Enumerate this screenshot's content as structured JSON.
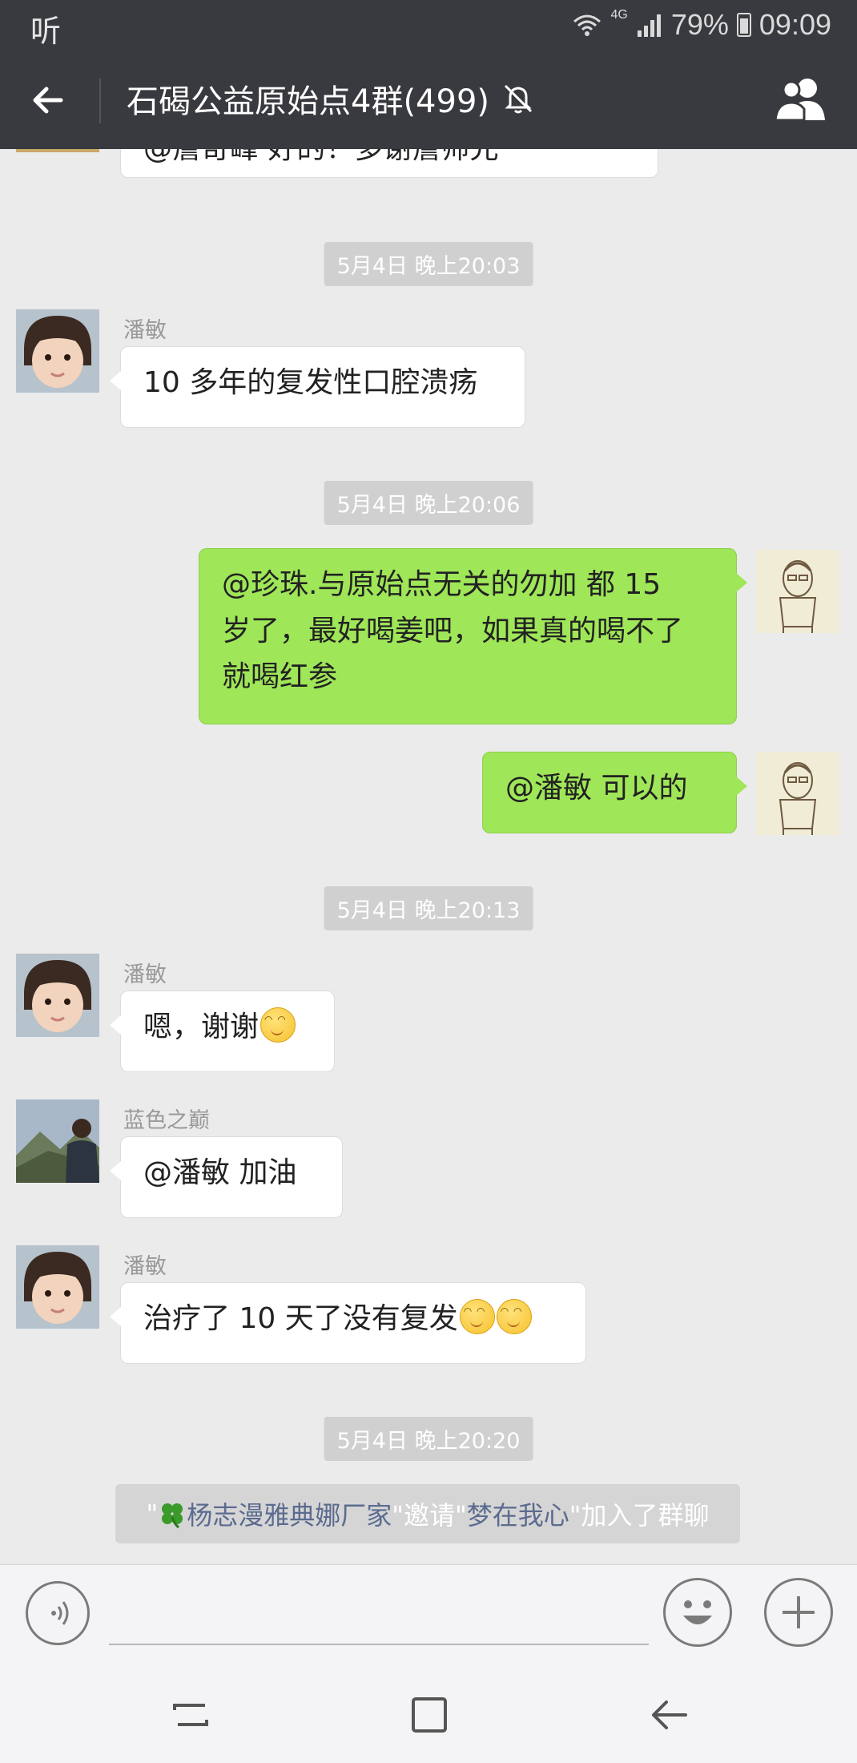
{
  "status_bar": {
    "left_app_label": "听",
    "network_type": "4G",
    "battery": "79%",
    "time": "09:09"
  },
  "header": {
    "title": "石碣公益原始点4群(499)",
    "icons": [
      "back-arrow-icon",
      "mute-bell-icon",
      "members-icon"
    ]
  },
  "chat": {
    "partial_top_message": "@詹奇峰 好的！多谢詹师兄",
    "items": [
      {
        "type": "timestamp",
        "text": "5月4日 晚上20:03"
      },
      {
        "type": "message",
        "side": "left",
        "sender": "潘敏",
        "text": "10 多年的复发性口腔溃疡"
      },
      {
        "type": "timestamp",
        "text": "5月4日 晚上20:06"
      },
      {
        "type": "message",
        "side": "right",
        "lines": [
          "@珍珠.与原始点无关的勿加  都 15",
          "岁了，最好喝姜吧，如果真的喝不了",
          "就喝红参"
        ]
      },
      {
        "type": "message",
        "side": "right",
        "text": "@潘敏  可以的"
      },
      {
        "type": "timestamp",
        "text": "5月4日 晚上20:13"
      },
      {
        "type": "message",
        "side": "left",
        "sender": "潘敏",
        "text": "嗯，谢谢",
        "emoji_count": 1
      },
      {
        "type": "message",
        "side": "left",
        "sender": "蓝色之巅",
        "text": "@潘敏  加油"
      },
      {
        "type": "message",
        "side": "left",
        "sender": "潘敏",
        "text": "治疗了 10 天了没有复发",
        "emoji_count": 2
      },
      {
        "type": "timestamp",
        "text": "5月4日 晚上20:20"
      }
    ],
    "system_message": {
      "quote_open": "\"",
      "inviter": "杨志漫雅典娜厂家",
      "mid": "\"邀请\"",
      "invitee": "梦在我心",
      "tail": "\"加入了群聊"
    }
  },
  "input_bar": {
    "icons": [
      "voice-icon",
      "emoji-icon",
      "plus-icon"
    ],
    "text_value": ""
  },
  "colors": {
    "header_bg": "#393a3f",
    "chat_bg": "#ebebeb",
    "outgoing_bubble": "#9fe658",
    "incoming_bubble": "#ffffff"
  }
}
